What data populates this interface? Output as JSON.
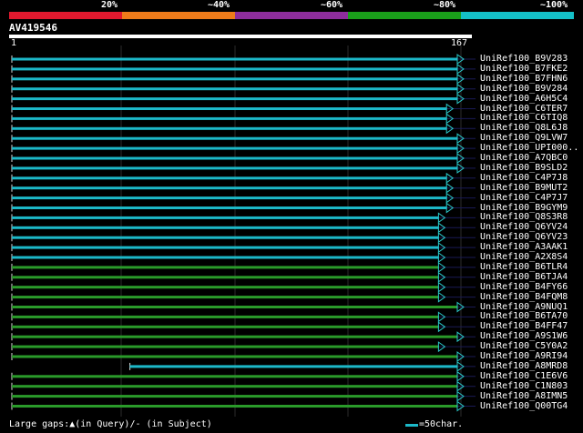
{
  "scale": {
    "labels": [
      "20%",
      "~40%",
      "~60%",
      "~80%",
      "~100%"
    ],
    "colors": [
      "#e0192e",
      "#ee7b1a",
      "#8e2d9c",
      "#1a9e1a",
      "#14c0c8"
    ]
  },
  "query": {
    "name": "AV419546",
    "start_label": "1",
    "end_label": "167",
    "length": 167
  },
  "colors": {
    "cyan": "#1cb8c8",
    "green": "#2a9a2a",
    "arrow": "#2ac8c8"
  },
  "hits": [
    {
      "name": "UniRef100_B9V283",
      "color": "cyan",
      "start": 1,
      "end": 167
    },
    {
      "name": "UniRef100_B7FKE2",
      "color": "cyan",
      "start": 1,
      "end": 167
    },
    {
      "name": "UniRef100_B7FHN6",
      "color": "cyan",
      "start": 1,
      "end": 167
    },
    {
      "name": "UniRef100_B9V284",
      "color": "cyan",
      "start": 1,
      "end": 167
    },
    {
      "name": "UniRef100_A6H5C4",
      "color": "cyan",
      "start": 1,
      "end": 167
    },
    {
      "name": "UniRef100_C6TER7",
      "color": "cyan",
      "start": 1,
      "end": 163
    },
    {
      "name": "UniRef100_C6TIQ8",
      "color": "cyan",
      "start": 1,
      "end": 163
    },
    {
      "name": "UniRef100_Q8L6J8",
      "color": "cyan",
      "start": 1,
      "end": 163
    },
    {
      "name": "UniRef100_Q9LVW7",
      "color": "cyan",
      "start": 1,
      "end": 167
    },
    {
      "name": "UniRef100_UPI000..",
      "color": "cyan",
      "start": 1,
      "end": 167
    },
    {
      "name": "UniRef100_A7QBC0",
      "color": "cyan",
      "start": 1,
      "end": 167
    },
    {
      "name": "UniRef100_B9SLD2",
      "color": "cyan",
      "start": 1,
      "end": 167
    },
    {
      "name": "UniRef100_C4P7J8",
      "color": "cyan",
      "start": 1,
      "end": 163
    },
    {
      "name": "UniRef100_B9MUT2",
      "color": "cyan",
      "start": 1,
      "end": 163
    },
    {
      "name": "UniRef100_C4P7J7",
      "color": "cyan",
      "start": 1,
      "end": 163
    },
    {
      "name": "UniRef100_B9GYM9",
      "color": "cyan",
      "start": 1,
      "end": 163
    },
    {
      "name": "UniRef100_Q8S3R8",
      "color": "cyan",
      "start": 1,
      "end": 160
    },
    {
      "name": "UniRef100_Q6YV24",
      "color": "cyan",
      "start": 1,
      "end": 160
    },
    {
      "name": "UniRef100_Q6YV23",
      "color": "cyan",
      "start": 1,
      "end": 160
    },
    {
      "name": "UniRef100_A3AAK1",
      "color": "cyan",
      "start": 1,
      "end": 160
    },
    {
      "name": "UniRef100_A2X8S4",
      "color": "cyan",
      "start": 1,
      "end": 160
    },
    {
      "name": "UniRef100_B6TLR4",
      "color": "green",
      "start": 1,
      "end": 160
    },
    {
      "name": "UniRef100_B6TJA4",
      "color": "green",
      "start": 1,
      "end": 160
    },
    {
      "name": "UniRef100_B4FY66",
      "color": "green",
      "start": 1,
      "end": 160
    },
    {
      "name": "UniRef100_B4FQM8",
      "color": "green",
      "start": 1,
      "end": 160
    },
    {
      "name": "UniRef100_A9NUQ1",
      "color": "green",
      "start": 1,
      "end": 167
    },
    {
      "name": "UniRef100_B6TA70",
      "color": "green",
      "start": 1,
      "end": 160
    },
    {
      "name": "UniRef100_B4FF47",
      "color": "green",
      "start": 1,
      "end": 160
    },
    {
      "name": "UniRef100_A9S1W6",
      "color": "green",
      "start": 1,
      "end": 167
    },
    {
      "name": "UniRef100_C5Y0A2",
      "color": "green",
      "start": 1,
      "end": 160
    },
    {
      "name": "UniRef100_A9RI94",
      "color": "green",
      "start": 1,
      "end": 167
    },
    {
      "name": "UniRef100_A8MRD8",
      "color": "cyan",
      "start": 45,
      "end": 167
    },
    {
      "name": "UniRef100_C1E6V6",
      "color": "green",
      "start": 1,
      "end": 167
    },
    {
      "name": "UniRef100_C1N803",
      "color": "green",
      "start": 1,
      "end": 167
    },
    {
      "name": "UniRef100_A8IMN5",
      "color": "green",
      "start": 1,
      "end": 167
    },
    {
      "name": "UniRef100_Q00TG4",
      "color": "green",
      "start": 1,
      "end": 167
    }
  ],
  "footer": {
    "legend": "Large gaps:▲(in Query)/- (in Subject)",
    "scale_label": "=50char."
  }
}
